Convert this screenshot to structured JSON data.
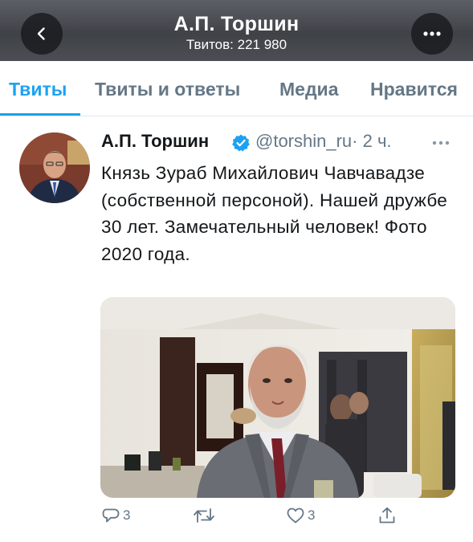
{
  "header": {
    "title": "А.П. Торшин",
    "subtitle": "Твитов: 221 980"
  },
  "tabs": [
    {
      "label": "Твиты",
      "active": true
    },
    {
      "label": "Твиты и ответы",
      "active": false
    },
    {
      "label": "Медиа",
      "active": false
    },
    {
      "label": "Нравится",
      "active": false
    }
  ],
  "tweet": {
    "author_name": "А.П. Торшин",
    "handle": "@torshin_ru",
    "time": "· 2 ч.",
    "verified": true,
    "text": "Князь Зураб Михайлович Чавчавадзе (собственной персоной). Нашей дружбе 30 лет. Замечательный человек! Фото 2020 года.",
    "actions": {
      "reply_count": "3",
      "retweet_count": "",
      "like_count": "3"
    }
  },
  "colors": {
    "accent": "#1da1f2",
    "secondary_text": "#657786",
    "header_bg": "#4a4d52"
  },
  "icons": {
    "back": "chevron-left-icon",
    "more": "ellipsis-icon",
    "verified": "verified-badge-icon",
    "reply": "reply-icon",
    "retweet": "retweet-icon",
    "like": "heart-icon",
    "share": "share-icon"
  }
}
